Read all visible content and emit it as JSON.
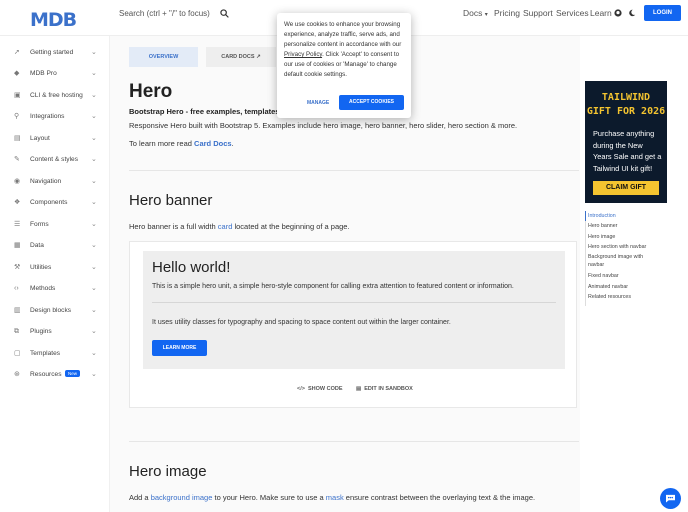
{
  "brand": {
    "logo": "MDB"
  },
  "search": {
    "placeholder": "Search (ctrl + \"/\" to focus)"
  },
  "nav": {
    "docs": "Docs",
    "pricing": "Pricing",
    "support": "Support",
    "services": "Services",
    "learn": "Learn",
    "login": "LOGIN"
  },
  "sidebar": {
    "items": [
      {
        "label": "Getting started",
        "icon": "rocket-icon"
      },
      {
        "label": "MDB Pro",
        "icon": "gem-icon"
      },
      {
        "label": "CLI & free hosting",
        "icon": "terminal-icon"
      },
      {
        "label": "Integrations",
        "icon": "plug-icon"
      },
      {
        "label": "Layout",
        "icon": "layout-icon"
      },
      {
        "label": "Content & styles",
        "icon": "brush-icon"
      },
      {
        "label": "Navigation",
        "icon": "compass-icon"
      },
      {
        "label": "Components",
        "icon": "cubes-icon"
      },
      {
        "label": "Forms",
        "icon": "forms-icon"
      },
      {
        "label": "Data",
        "icon": "table-icon"
      },
      {
        "label": "Utilities",
        "icon": "wrench-icon"
      },
      {
        "label": "Methods",
        "icon": "code-icon"
      },
      {
        "label": "Design blocks",
        "icon": "blocks-icon"
      },
      {
        "label": "Plugins",
        "icon": "plugin-icon"
      },
      {
        "label": "Templates",
        "icon": "template-icon"
      },
      {
        "label": "Resources",
        "icon": "resources-icon",
        "badge": "New"
      }
    ]
  },
  "tabs": {
    "overview": "OVERVIEW",
    "card_docs": "CARD DOCS"
  },
  "page": {
    "title": "Hero",
    "subtitle": "Bootstrap Hero - free examples, templates & tu",
    "description": "Responsive Hero built with Bootstrap 5. Examples include hero image, hero banner, hero slider, hero section & more.",
    "learn_more_prefix": "To learn more read ",
    "learn_more_link": "Card Docs",
    "learn_more_suffix": "."
  },
  "hero_banner": {
    "heading": "Hero banner",
    "text_prefix": "Hero banner is a full width ",
    "text_link": "card",
    "text_suffix": " located at the beginning of a page.",
    "demo": {
      "title": "Hello world!",
      "line1": "This is a simple hero unit, a simple hero-style component for calling extra attention to featured content or information.",
      "line2": "It uses utility classes for typography and spacing to space content out within the larger container.",
      "button": "LEARN MORE"
    },
    "show_code": "SHOW CODE",
    "edit_sandbox": "EDIT IN SANDBOX"
  },
  "hero_image": {
    "heading": "Hero image",
    "text_1": "Add a ",
    "link_1": "background image",
    "text_2": " to your Hero. Make sure to use a ",
    "link_2": "mask",
    "text_3": " ensure contrast between the overlaying text & the image."
  },
  "cookie": {
    "text_1": "We use cookies to enhance your browsing experience, analyze traffic, serve ads, and personalize content in accordance with our ",
    "policy_link": "Privacy Policy",
    "text_2": ". Click 'Accept' to consent to our use of cookies or 'Manage' to change default cookie settings.",
    "manage": "MANAGE",
    "accept": "ACCEPT COOKIES"
  },
  "ad": {
    "line1": "TAILWIND",
    "line2": "GIFT FOR 2026",
    "body": "Purchase anything during the New Years Sale and get a Tailwind UI kit gift!",
    "cta": "CLAIM GIFT"
  },
  "toc": {
    "items": [
      "Introduction",
      "Hero banner",
      "Hero image",
      "Hero section with navbar",
      "Background image with navbar",
      "Fixed navbar",
      "Animated navbar",
      "Related resources"
    ]
  },
  "colors": {
    "primary": "#1266f1",
    "link": "#3b71ca",
    "ad_bg": "#0c1a2c",
    "ad_accent": "#f4c430"
  }
}
